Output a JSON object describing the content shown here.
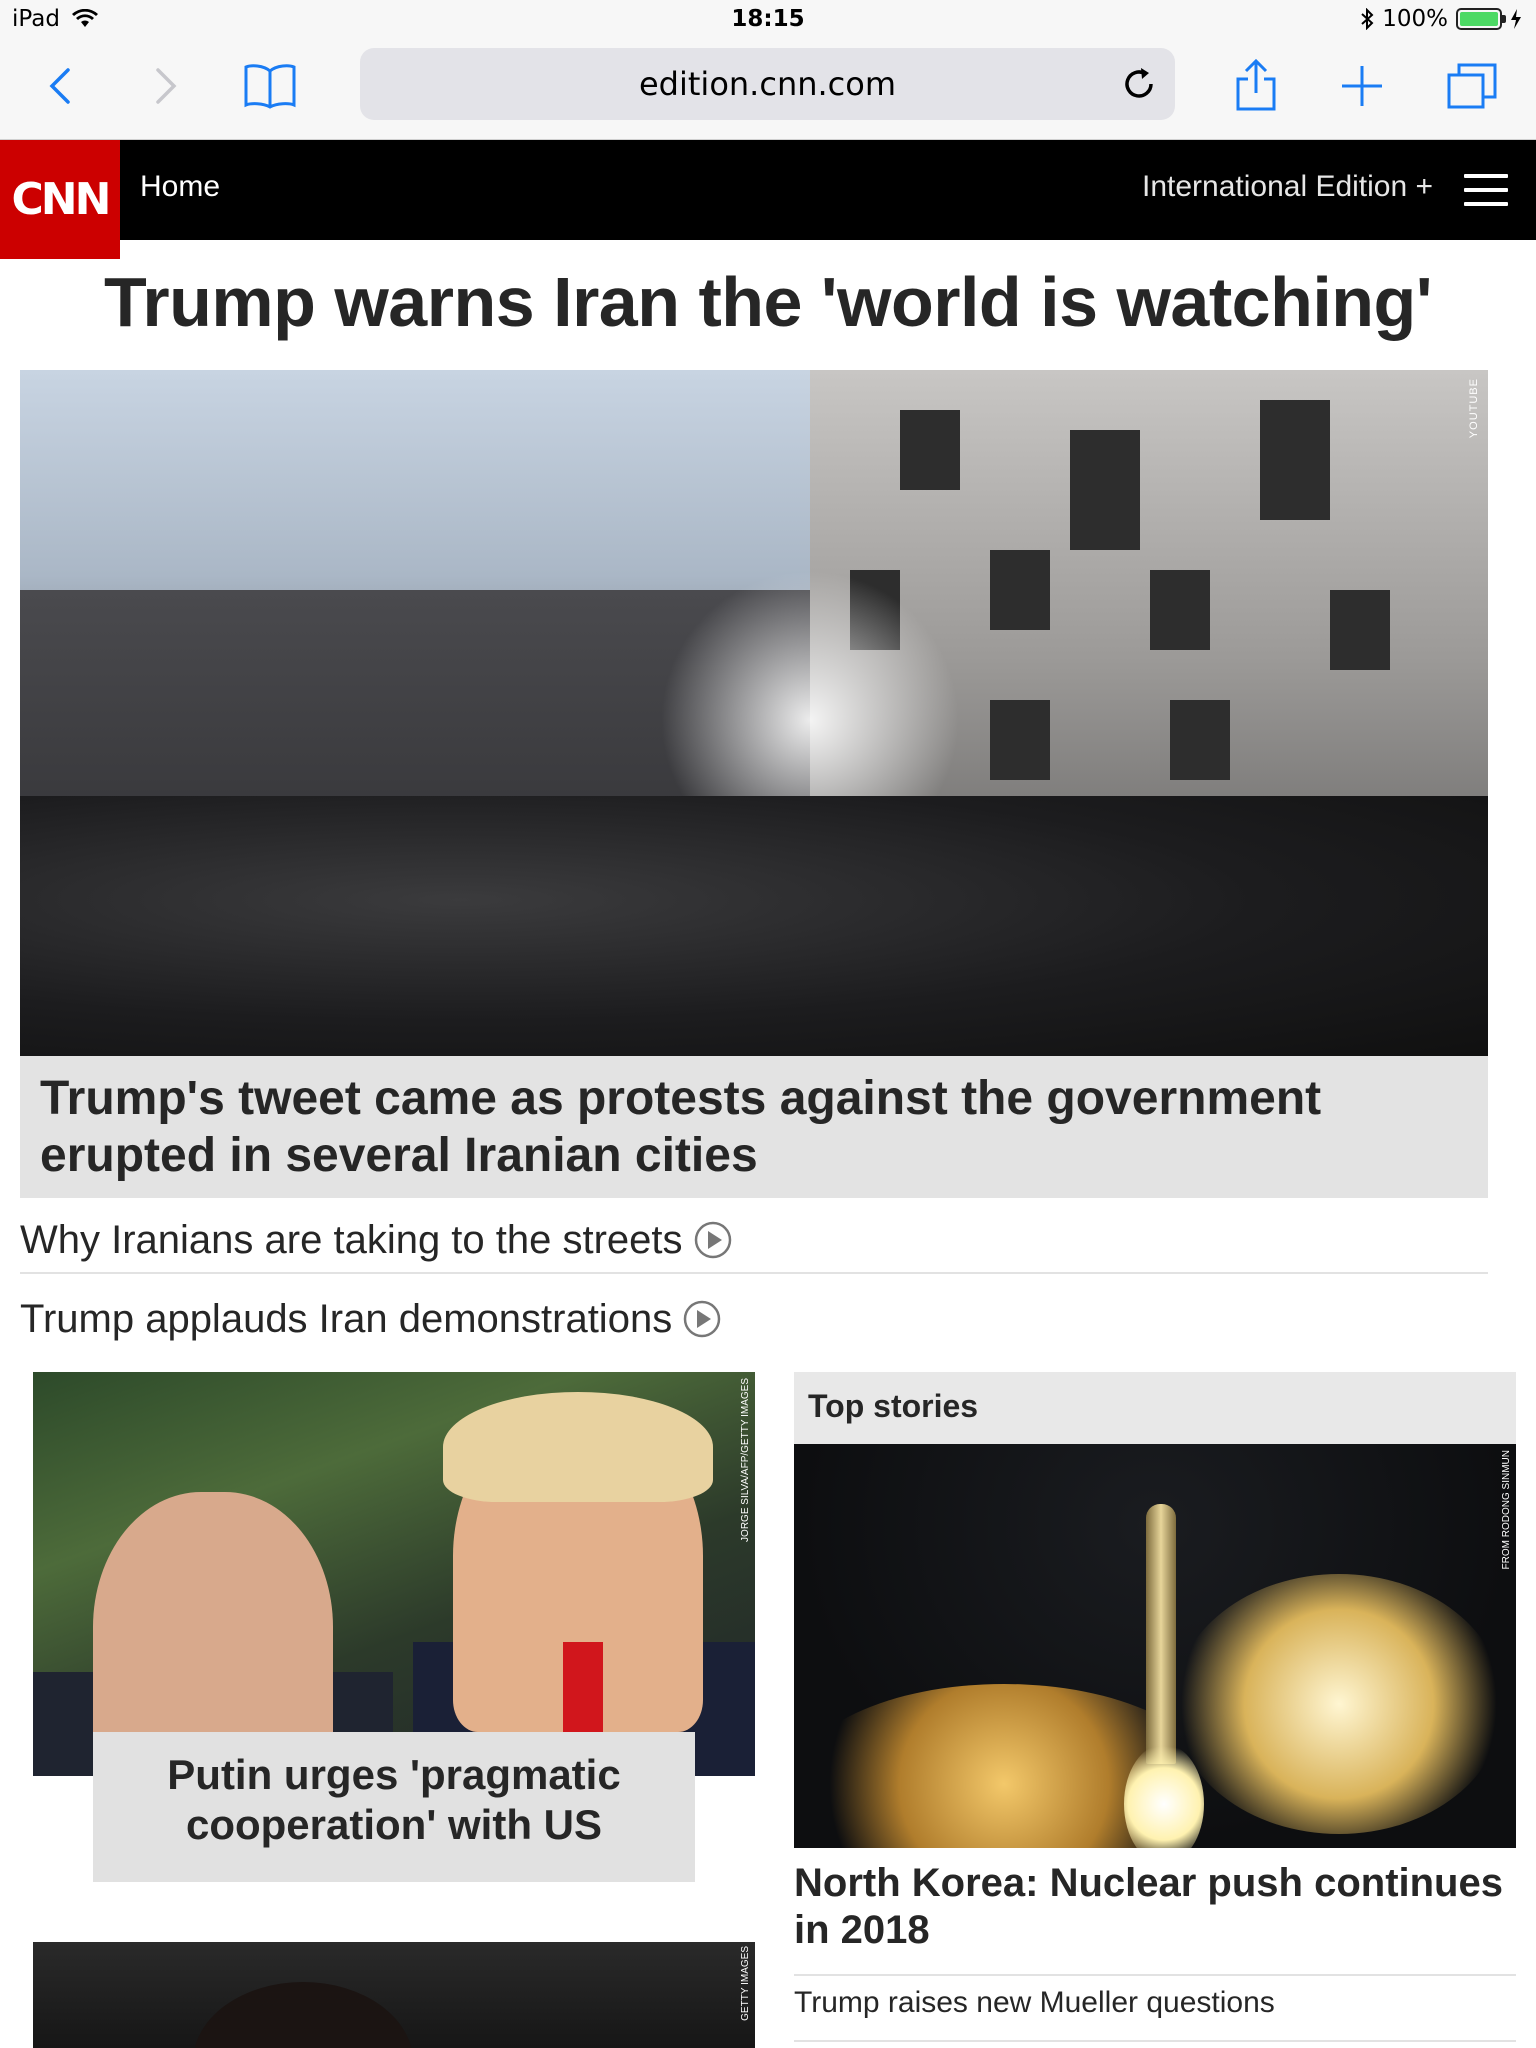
{
  "status_bar": {
    "device": "iPad",
    "time": "18:15",
    "battery_percent": "100%",
    "battery_level": 1.0,
    "icons": [
      "wifi-icon",
      "bluetooth-icon",
      "battery-icon",
      "charging-icon"
    ]
  },
  "browser": {
    "url": "edition.cnn.com",
    "buttons": [
      "back-icon",
      "forward-icon",
      "bookmarks-icon",
      "reload-icon",
      "share-icon",
      "new-tab-icon",
      "tabs-icon"
    ],
    "accent_color": "#1a7cf4"
  },
  "cnn_nav": {
    "logo_text": "CNN",
    "home_label": "Home",
    "edition_label": "International Edition +",
    "brand_color": "#cc0000"
  },
  "main": {
    "headline": "Trump warns Iran the 'world is watching'",
    "hero_credit": "YOUTUBE",
    "hero_caption": "Trump's tweet came as protests against the government erupted in several Iranian cities",
    "related": [
      {
        "label": "Why Iranians are taking to the streets"
      },
      {
        "label": "Trump applauds Iran demonstrations"
      }
    ]
  },
  "left_column": {
    "card1_credit": "JORGE SILVA/AFP/GETTY IMAGES",
    "card1_caption": "Putin urges 'pragmatic cooperation' with US",
    "card2_credit": "GETTY IMAGES"
  },
  "top_stories": {
    "label": "Top stories",
    "image_credit": "FROM RODONG SINMUN",
    "headline": "North Korea: Nuclear push continues in 2018",
    "link": "Trump raises new Mueller questions"
  }
}
